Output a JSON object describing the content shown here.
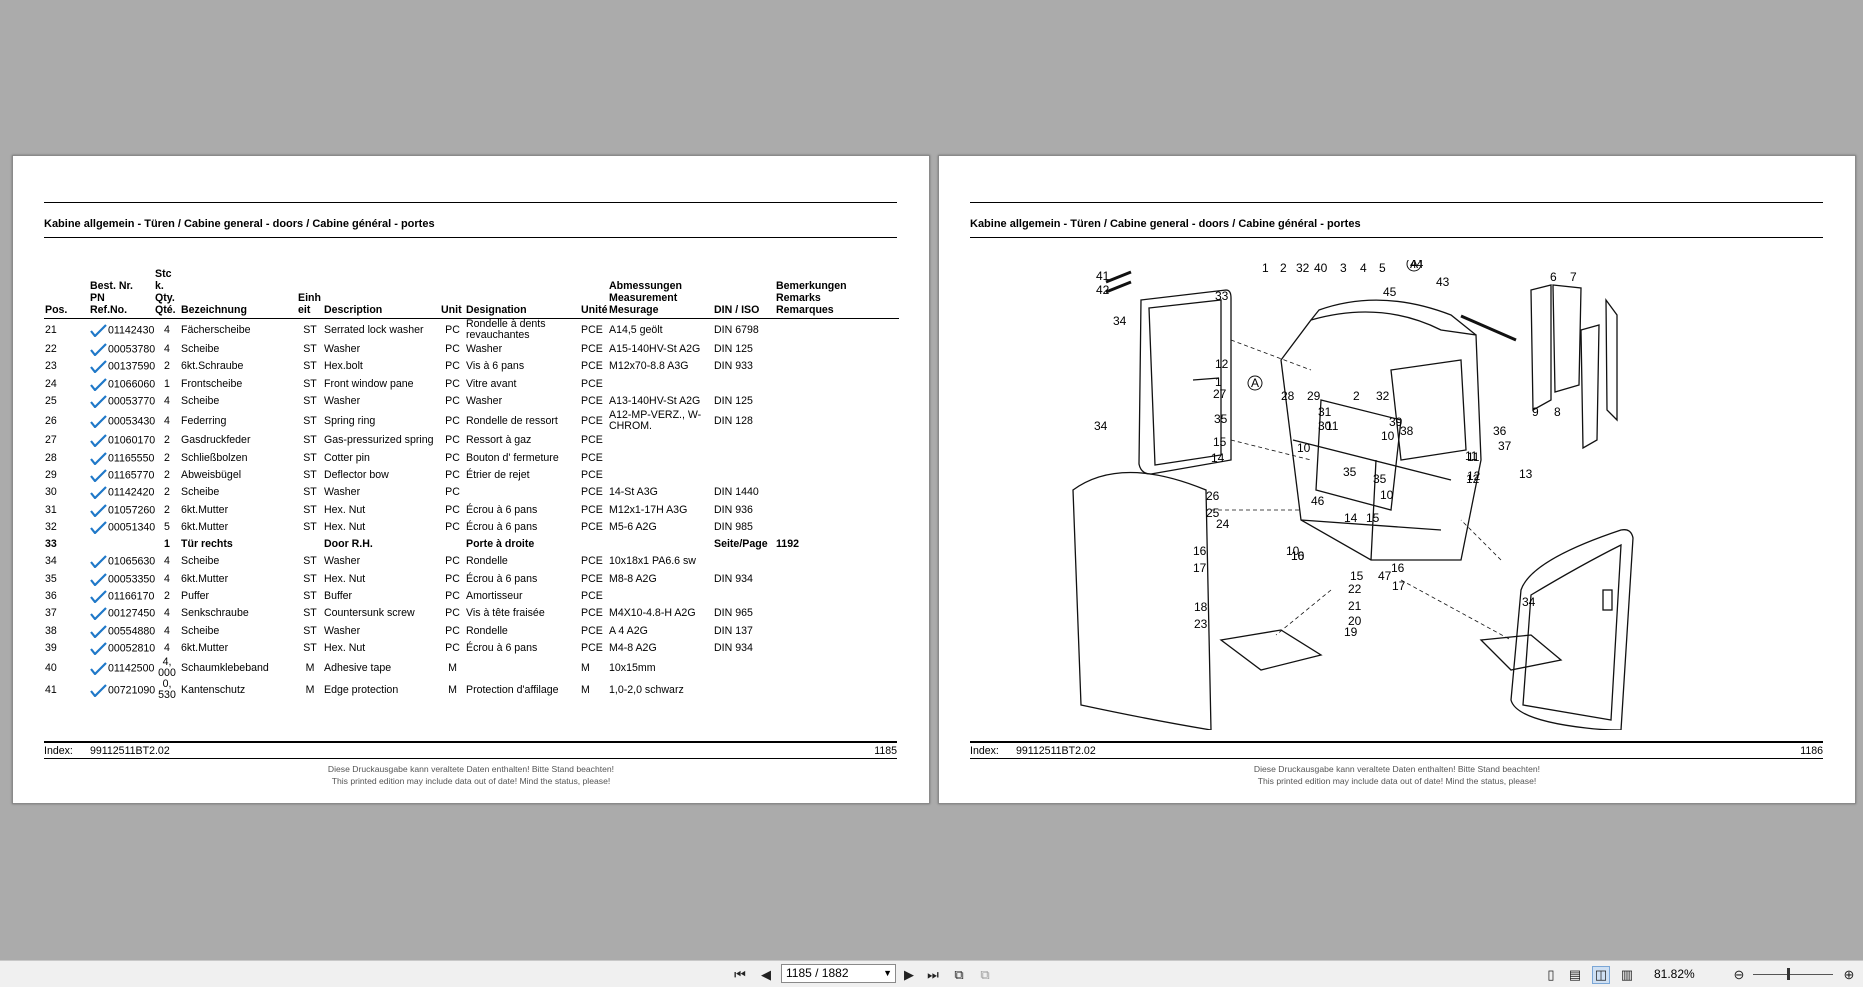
{
  "left_page": {
    "title": "Kabine allgemein - Türen / Cabine general - doors / Cabine général - portes",
    "headers": {
      "pos": "Pos.",
      "bestnr": "Best. Nr.\nPN\nRef.No.",
      "qty": "Stc\nk.\nQty.\nQté.",
      "bezeichnung": "Bezeichnung",
      "einheit": "Einh\neit",
      "description": "Description",
      "unit": "Unit",
      "designation": "Designation",
      "unite": "Unité",
      "abmessungen": "Abmessungen\nMeasurement\nMesurage",
      "din": "DIN / ISO",
      "bemerkungen": "Bemerkungen\nRemarks\nRemarques"
    },
    "rows": [
      {
        "pos": "21",
        "pn": "01142430",
        "check": true,
        "qty": "4",
        "bez": "Fächerscheibe",
        "einh": "ST",
        "desc": "Serrated lock washer",
        "unit": "PC",
        "desig": "Rondelle à dents revauchantes",
        "unite": "PCE",
        "abm": "A14,5 geölt",
        "din": "DIN 6798",
        "rem": ""
      },
      {
        "pos": "22",
        "pn": "00053780",
        "check": true,
        "qty": "4",
        "bez": "Scheibe",
        "einh": "ST",
        "desc": "Washer",
        "unit": "PC",
        "desig": "Washer",
        "unite": "PCE",
        "abm": "A15-140HV-St A2G",
        "din": "DIN 125",
        "rem": ""
      },
      {
        "pos": "23",
        "pn": "00137590",
        "check": true,
        "qty": "2",
        "bez": "6kt.Schraube",
        "einh": "ST",
        "desc": "Hex.bolt",
        "unit": "PC",
        "desig": "Vis à 6 pans",
        "unite": "PCE",
        "abm": "M12x70-8.8 A3G",
        "din": "DIN 933",
        "rem": ""
      },
      {
        "pos": "24",
        "pn": "01066060",
        "check": true,
        "qty": "1",
        "bez": "Frontscheibe",
        "einh": "ST",
        "desc": "Front window pane",
        "unit": "PC",
        "desig": "Vitre avant",
        "unite": "PCE",
        "abm": "",
        "din": "",
        "rem": ""
      },
      {
        "pos": "25",
        "pn": "00053770",
        "check": true,
        "qty": "4",
        "bez": "Scheibe",
        "einh": "ST",
        "desc": "Washer",
        "unit": "PC",
        "desig": "Washer",
        "unite": "PCE",
        "abm": "A13-140HV-St A2G",
        "din": "DIN 125",
        "rem": ""
      },
      {
        "pos": "26",
        "pn": "00053430",
        "check": true,
        "qty": "4",
        "bez": "Federring",
        "einh": "ST",
        "desc": "Spring ring",
        "unit": "PC",
        "desig": "Rondelle de ressort",
        "unite": "PCE",
        "abm": "A12-MP-VERZ., W-CHROM.",
        "din": "DIN 128",
        "rem": ""
      },
      {
        "pos": "27",
        "pn": "01060170",
        "check": true,
        "qty": "2",
        "bez": "Gasdruckfeder",
        "einh": "ST",
        "desc": "Gas-pressurized spring",
        "unit": "PC",
        "desig": "Ressort à gaz",
        "unite": "PCE",
        "abm": "",
        "din": "",
        "rem": ""
      },
      {
        "pos": "28",
        "pn": "01165550",
        "check": true,
        "qty": "2",
        "bez": "Schließbolzen",
        "einh": "ST",
        "desc": "Cotter pin",
        "unit": "PC",
        "desig": "Bouton d' fermeture",
        "unite": "PCE",
        "abm": "",
        "din": "",
        "rem": ""
      },
      {
        "pos": "29",
        "pn": "01165770",
        "check": true,
        "qty": "2",
        "bez": "Abweisbügel",
        "einh": "ST",
        "desc": "Deflector bow",
        "unit": "PC",
        "desig": "Étrier de rejet",
        "unite": "PCE",
        "abm": "",
        "din": "",
        "rem": ""
      },
      {
        "pos": "30",
        "pn": "01142420",
        "check": true,
        "qty": "2",
        "bez": "Scheibe",
        "einh": "ST",
        "desc": "Washer",
        "unit": "PC",
        "desig": "",
        "unite": "PCE",
        "abm": "14-St A3G",
        "din": "DIN 1440",
        "rem": ""
      },
      {
        "pos": "31",
        "pn": "01057260",
        "check": true,
        "qty": "2",
        "bez": "6kt.Mutter",
        "einh": "ST",
        "desc": "Hex. Nut",
        "unit": "PC",
        "desig": "Écrou à 6 pans",
        "unite": "PCE",
        "abm": "M12x1-17H A3G",
        "din": "DIN 936",
        "rem": ""
      },
      {
        "pos": "32",
        "pn": "00051340",
        "check": true,
        "qty": "5",
        "bez": "6kt.Mutter",
        "einh": "ST",
        "desc": "Hex. Nut",
        "unit": "PC",
        "desig": "Écrou à 6 pans",
        "unite": "PCE",
        "abm": "M5-6 A2G",
        "din": "DIN 985",
        "rem": ""
      },
      {
        "pos": "33",
        "pn": "",
        "check": false,
        "qty": "1",
        "bez": "Tür rechts",
        "einh": "",
        "desc": "Door R.H.",
        "unit": "",
        "desig": "Porte à droite",
        "unite": "",
        "abm": "",
        "din": "Seite/Page",
        "rem": "1192",
        "bold": true
      },
      {
        "pos": "34",
        "pn": "01065630",
        "check": true,
        "qty": "4",
        "bez": "Scheibe",
        "einh": "ST",
        "desc": "Washer",
        "unit": "PC",
        "desig": "Rondelle",
        "unite": "PCE",
        "abm": "10x18x1 PA6.6 sw",
        "din": "",
        "rem": ""
      },
      {
        "pos": "35",
        "pn": "00053350",
        "check": true,
        "qty": "4",
        "bez": "6kt.Mutter",
        "einh": "ST",
        "desc": "Hex. Nut",
        "unit": "PC",
        "desig": "Écrou à 6 pans",
        "unite": "PCE",
        "abm": "M8-8 A2G",
        "din": "DIN 934",
        "rem": ""
      },
      {
        "pos": "36",
        "pn": "01166170",
        "check": true,
        "qty": "2",
        "bez": "Puffer",
        "einh": "ST",
        "desc": "Buffer",
        "unit": "PC",
        "desig": "Amortisseur",
        "unite": "PCE",
        "abm": "",
        "din": "",
        "rem": ""
      },
      {
        "pos": "37",
        "pn": "00127450",
        "check": true,
        "qty": "4",
        "bez": "Senkschraube",
        "einh": "ST",
        "desc": "Countersunk screw",
        "unit": "PC",
        "desig": "Vis à tête fraisée",
        "unite": "PCE",
        "abm": "M4X10-4.8-H A2G",
        "din": "DIN 965",
        "rem": ""
      },
      {
        "pos": "38",
        "pn": "00554880",
        "check": true,
        "qty": "4",
        "bez": "Scheibe",
        "einh": "ST",
        "desc": "Washer",
        "unit": "PC",
        "desig": "Rondelle",
        "unite": "PCE",
        "abm": "A 4 A2G",
        "din": "DIN 137",
        "rem": ""
      },
      {
        "pos": "39",
        "pn": "00052810",
        "check": true,
        "qty": "4",
        "bez": "6kt.Mutter",
        "einh": "ST",
        "desc": "Hex. Nut",
        "unit": "PC",
        "desig": "Écrou à 6 pans",
        "unite": "PCE",
        "abm": "M4-8 A2G",
        "din": "DIN 934",
        "rem": ""
      },
      {
        "pos": "40",
        "pn": "01142500",
        "check": true,
        "qty": "4,\n000",
        "bez": "Schaumklebeband",
        "einh": "M",
        "desc": "Adhesive tape",
        "unit": "M",
        "desig": "",
        "unite": "M",
        "abm": "10x15mm",
        "din": "",
        "rem": ""
      },
      {
        "pos": "41",
        "pn": "00721090",
        "check": true,
        "qty": "0,\n530",
        "bez": "Kantenschutz",
        "einh": "M",
        "desc": "Edge protection",
        "unit": "M",
        "desig": "Protection d'affilage",
        "unite": "M",
        "abm": "1,0-2,0 schwarz",
        "din": "",
        "rem": ""
      }
    ],
    "index_label": "Index:",
    "index_value": "99112511BT2.02",
    "page_number": "1185",
    "footer_de": "Diese Druckausgabe kann veraltete Daten enthalten! Bitte Stand beachten!",
    "footer_en": "This printed edition may include data out of date! Mind the status, please!"
  },
  "right_page": {
    "title": "Kabine allgemein - Türen / Cabine general - doors / Cabine général - portes",
    "index_label": "Index:",
    "index_value": "99112511BT2.02",
    "page_number": "1186",
    "footer_de": "Diese Druckausgabe kann veraltete Daten enthalten! Bitte Stand beachten!",
    "footer_en": "This printed edition may include data out of date! Mind the status, please!",
    "callouts": [
      "41",
      "42",
      "33",
      "34",
      "34",
      "24",
      "16",
      "17",
      "18",
      "23",
      "1",
      "2",
      "32",
      "40",
      "3",
      "4",
      "5",
      "44",
      "A",
      "43",
      "45",
      "12",
      "1",
      "A",
      "27",
      "28",
      "29",
      "35",
      "15",
      "14",
      "26",
      "25",
      "31",
      "30",
      "2",
      "32",
      "11",
      "10",
      "39",
      "38",
      "10",
      "11",
      "12",
      "35",
      "35",
      "46",
      "10",
      "14",
      "15",
      "10",
      "15",
      "47",
      "22",
      "21",
      "20",
      "16",
      "17",
      "19",
      "16",
      "10",
      "34",
      "13",
      "12",
      "11",
      "36",
      "37",
      "6",
      "7",
      "9",
      "8"
    ]
  },
  "toolbar": {
    "page_field": "1185 / 1882",
    "zoom": "81.82%",
    "icons": [
      "first-page-icon",
      "prev-page-icon",
      "next-page-icon",
      "last-page-icon",
      "rotate-icon",
      "copy-icon",
      "single-page-icon",
      "continuous-icon",
      "two-page-icon",
      "two-page-continuous-icon",
      "zoom-out-icon",
      "zoom-in-icon"
    ]
  },
  "colors": {
    "background": "#ababab",
    "check": "#1f78c8",
    "page": "#ffffff",
    "toolbar": "#f0f0f0"
  }
}
